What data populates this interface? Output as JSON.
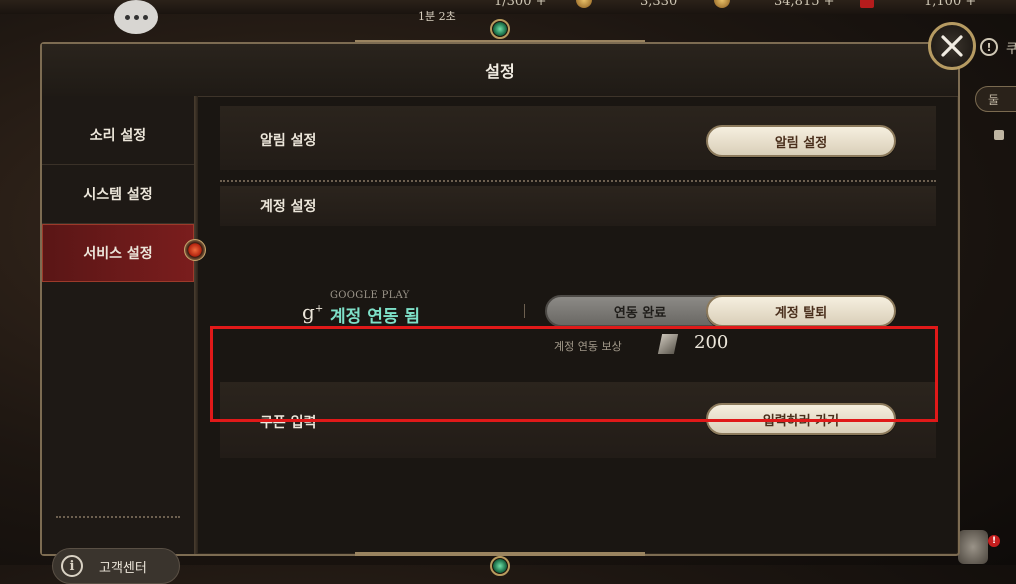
{
  "hud": {
    "items": [
      "1/300 +",
      "3,330",
      "34,815 +",
      "1,100 +"
    ],
    "timer": "1분 2초"
  },
  "dialog": {
    "title": "설정",
    "close_icon": "close-icon"
  },
  "sidebar": {
    "items": [
      {
        "label": "소리 설정",
        "active": false
      },
      {
        "label": "시스템 설정",
        "active": false
      },
      {
        "label": "서비스 설정",
        "active": true
      }
    ],
    "support_label": "고객센터"
  },
  "main": {
    "notification": {
      "title": "알림 설정",
      "button": "알림 설정"
    },
    "account_section_title": "계정 설정",
    "google": {
      "provider": "GOOGLE PLAY",
      "status": "계정 연동 됨",
      "linked_button": "연동 완료",
      "withdraw_button": "계정 탈퇴",
      "reward_label": "계정 연동 보상",
      "reward_value": "200"
    },
    "coupon": {
      "title": "쿠폰 입력",
      "button": "입력하러 가기"
    }
  },
  "right_hud": {
    "text": "쿠",
    "pill": "둘"
  },
  "colors": {
    "accent_green": "#7ee0c8",
    "active_tab": "#7a1d1d",
    "highlight": "#e01919",
    "button_cream": "#f0e8d6"
  }
}
